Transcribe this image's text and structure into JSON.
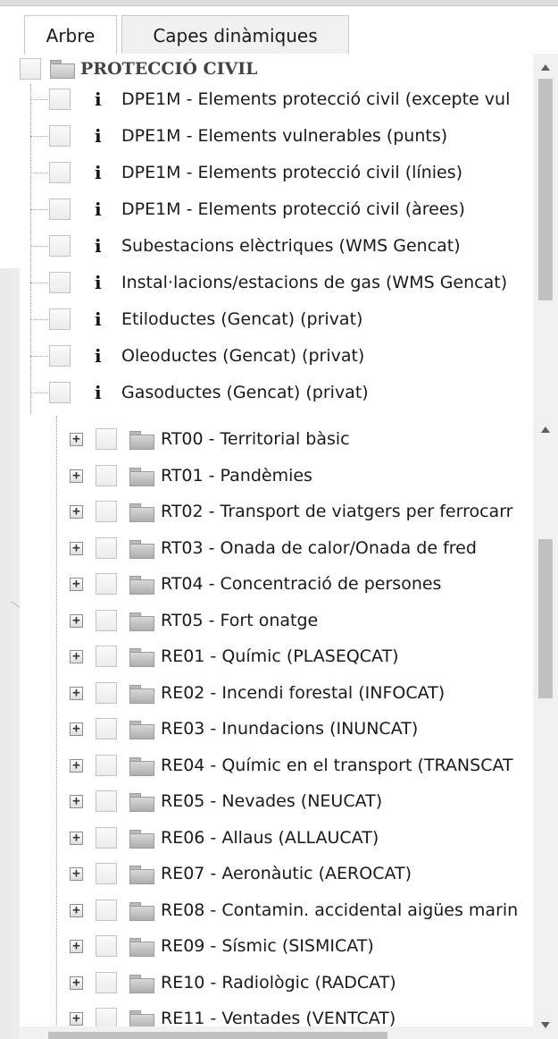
{
  "tabs": [
    {
      "label": "Arbre",
      "active": true
    },
    {
      "label": "Capes dinàmiques",
      "active": false
    }
  ],
  "root": {
    "label": "PROTECCIÓ CIVIL"
  },
  "layers": [
    {
      "info": "i",
      "label": "DPE1M - Elements protecció civil (excepte vul"
    },
    {
      "info": "i",
      "label": "DPE1M - Elements vulnerables (punts)"
    },
    {
      "info": "i",
      "label": "DPE1M - Elements protecció civil (línies)"
    },
    {
      "info": "i",
      "label": "DPE1M - Elements protecció civil (àrees)"
    },
    {
      "info": "i",
      "label": "Subestacions elèctriques (WMS Gencat)"
    },
    {
      "info": "i",
      "label": "Instal·lacions/estacions de gas (WMS Gencat)"
    },
    {
      "info": "i",
      "label": "Etiloductes (Gencat) (privat)"
    },
    {
      "info": "i",
      "label": "Oleoductes (Gencat) (privat)"
    },
    {
      "info": "i",
      "label": "Gasoductes (Gencat) (privat)"
    }
  ],
  "folders": [
    {
      "expander": "+",
      "label": "RT00 - Territorial bàsic"
    },
    {
      "expander": "+",
      "label": "RT01 - Pandèmies"
    },
    {
      "expander": "+",
      "label": "RT02 - Transport de viatgers per ferrocarr"
    },
    {
      "expander": "+",
      "label": "RT03 - Onada de calor/Onada de fred"
    },
    {
      "expander": "+",
      "label": "RT04 - Concentració de persones"
    },
    {
      "expander": "+",
      "label": "RT05 - Fort onatge"
    },
    {
      "expander": "+",
      "label": "RE01 - Químic (PLASEQCAT)"
    },
    {
      "expander": "+",
      "label": "RE02 - Incendi forestal (INFOCAT)"
    },
    {
      "expander": "+",
      "label": "RE03 - Inundacions (INUNCAT)"
    },
    {
      "expander": "+",
      "label": "RE04 - Químic en el transport (TRANSCAT"
    },
    {
      "expander": "+",
      "label": "RE05 - Nevades (NEUCAT)"
    },
    {
      "expander": "+",
      "label": "RE06 - Allaus (ALLAUCAT)"
    },
    {
      "expander": "+",
      "label": "RE07 - Aeronàutic (AEROCAT)"
    },
    {
      "expander": "+",
      "label": "RE08 - Contamin. accidental aigües marin"
    },
    {
      "expander": "+",
      "label": "RE09 - Sísmic (SISMICAT)"
    },
    {
      "expander": "+",
      "label": "RE10 - Radiològic (RADCAT)"
    },
    {
      "expander": "+",
      "label": "RE11 - Ventades (VENTCAT)"
    }
  ]
}
